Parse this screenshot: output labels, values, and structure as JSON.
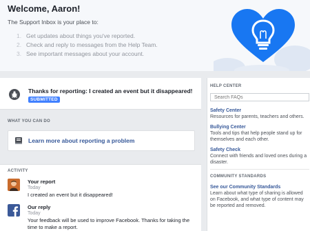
{
  "welcome": {
    "title": "Welcome, Aaron!",
    "intro": "The Support Inbox is your place to:",
    "steps": [
      {
        "num": "1.",
        "text": "Get updates about things you've reported."
      },
      {
        "num": "2.",
        "text": "Check and reply to messages from the Help Team."
      },
      {
        "num": "3.",
        "text": "See important messages about your account."
      }
    ],
    "illustration": "heart-lightbulb-icon",
    "colors": {
      "heart": "#1877f2",
      "heart_shadow": "#d8e4f5"
    }
  },
  "report": {
    "icon": "bug-icon",
    "title": "Thanks for reporting: I created an event but it disappeared!",
    "status": "SUBMITTED",
    "status_color": "#4080ff"
  },
  "what_you_can_do": {
    "label": "WHAT YOU CAN DO",
    "action_icon": "book-icon",
    "action_label": "Learn more about reporting a problem"
  },
  "activity": {
    "label": "ACTIVITY",
    "items": [
      {
        "avatar": "user-avatar",
        "name": "Your report",
        "time": "Today",
        "text": "I created an event but it disappeared!"
      },
      {
        "avatar": "facebook-logo-icon",
        "name": "Our reply",
        "time": "Today",
        "text": "Your feedback will be used to improve Facebook. Thanks for taking the time to make a report."
      }
    ]
  },
  "help_center": {
    "label": "HELP CENTER",
    "search_placeholder": "Search FAQs",
    "items": [
      {
        "title": "Safety Center",
        "desc": "Resources for parents, teachers and others."
      },
      {
        "title": "Bullying Center",
        "desc": "Tools and tips that help people stand up for themselves and each other."
      },
      {
        "title": "Safety Check",
        "desc": "Connect with friends and loved ones during a disaster."
      }
    ]
  },
  "community": {
    "label": "COMMUNITY STANDARDS",
    "link": "See our Community Standards",
    "desc": "Learn about what type of sharing is allowed on Facebook, and what type of content may be reported and removed."
  }
}
